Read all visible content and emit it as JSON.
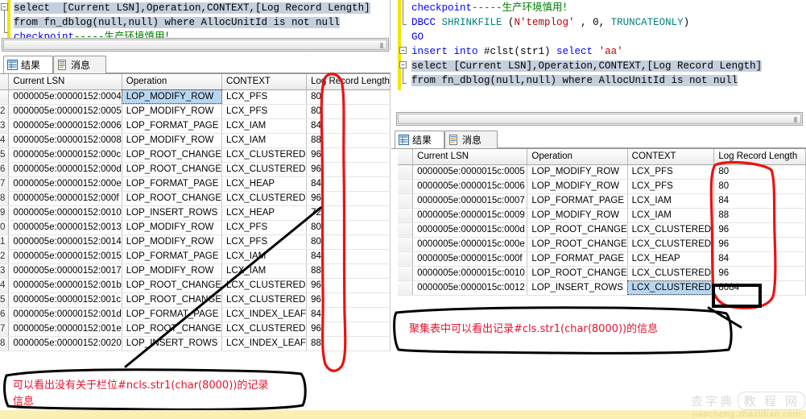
{
  "left_editor": {
    "lines": [
      {
        "segments": [
          {
            "t": "select  [Current LSN],Operation,CONTEXT,[Log Record Length]",
            "c": "sel"
          }
        ]
      },
      {
        "segments": [
          {
            "t": "from fn_dblog(null,null) where AllocUnitId is not null",
            "c": "sel"
          }
        ]
      },
      {
        "segments": [
          {
            "t": "checkpoint",
            "c": "kw"
          },
          {
            "t": "-----",
            "c": "green-note"
          },
          {
            "t": "生产环境慎用！",
            "c": "green-note"
          }
        ]
      }
    ]
  },
  "right_editor": {
    "lines": [
      {
        "segments": [
          {
            "t": "checkpoint",
            "c": "kw"
          },
          {
            "t": "-----",
            "c": "green-note"
          },
          {
            "t": "生产环境慎用！",
            "c": "green-note"
          }
        ]
      },
      {
        "segments": [
          {
            "t": "DBCC ",
            "c": "kw"
          },
          {
            "t": "SHRINKFILE",
            "c": "teal"
          },
          {
            "t": " (",
            "c": "fn"
          },
          {
            "t": "N'templog'",
            "c": "red"
          },
          {
            "t": " , ",
            "c": "fn"
          },
          {
            "t": "0",
            "c": "fn"
          },
          {
            "t": ", ",
            "c": "fn"
          },
          {
            "t": "TRUNCATEONLY",
            "c": "teal"
          },
          {
            "t": ")",
            "c": "fn"
          }
        ]
      },
      {
        "segments": [
          {
            "t": "GO",
            "c": "kw"
          }
        ]
      },
      {
        "segments": [
          {
            "t": "insert into ",
            "c": "kw"
          },
          {
            "t": "#clst",
            "c": "fn"
          },
          {
            "t": "(str1) ",
            "c": "fn"
          },
          {
            "t": "select ",
            "c": "kw"
          },
          {
            "t": "'aa'",
            "c": "red"
          }
        ]
      },
      {
        "segments": [
          {
            "t": "select [Current LSN],Operation,CONTEXT,[Log Record Length]",
            "c": "sel"
          }
        ]
      },
      {
        "segments": [
          {
            "t": "from fn_dblog(null,null) where AllocUnitId is not null",
            "c": "sel"
          }
        ]
      }
    ]
  },
  "scrollbar": {
    "grip_glyph": "⦀"
  },
  "tabs": {
    "results_label": "结果",
    "messages_label": "消息",
    "results_icon": "grid-icon",
    "messages_icon": "document-icon"
  },
  "left_grid": {
    "columns": [
      "",
      "Current LSN",
      "Operation",
      "CONTEXT",
      "Log Record Length"
    ],
    "rows": [
      {
        "n": "",
        "lsn": "0000005e:00000152:0004",
        "op": "LOP_MODIFY_ROW",
        "ctx": "LCX_PFS",
        "len": "80",
        "selected": true
      },
      {
        "n": "2",
        "lsn": "0000005e:00000152:0005",
        "op": "LOP_MODIFY_ROW",
        "ctx": "LCX_PFS",
        "len": "80"
      },
      {
        "n": "3",
        "lsn": "0000005e:00000152:0006",
        "op": "LOP_FORMAT_PAGE",
        "ctx": "LCX_IAM",
        "len": "84"
      },
      {
        "n": "4",
        "lsn": "0000005e:00000152:0008",
        "op": "LOP_MODIFY_ROW",
        "ctx": "LCX_IAM",
        "len": "88"
      },
      {
        "n": "5",
        "lsn": "0000005e:00000152:000c",
        "op": "LOP_ROOT_CHANGE",
        "ctx": "LCX_CLUSTERED",
        "len": "96"
      },
      {
        "n": "6",
        "lsn": "0000005e:00000152:000d",
        "op": "LOP_ROOT_CHANGE",
        "ctx": "LCX_CLUSTERED",
        "len": "96"
      },
      {
        "n": "7",
        "lsn": "0000005e:00000152:000e",
        "op": "LOP_FORMAT_PAGE",
        "ctx": "LCX_HEAP",
        "len": "84"
      },
      {
        "n": "8",
        "lsn": "0000005e:00000152:000f",
        "op": "LOP_ROOT_CHANGE",
        "ctx": "LCX_CLUSTERED",
        "len": "96"
      },
      {
        "n": "9",
        "lsn": "0000005e:00000152:0010",
        "op": "LOP_INSERT_ROWS",
        "ctx": "LCX_HEAP",
        "len": "72"
      },
      {
        "n": "0",
        "lsn": "0000005e:00000152:0013",
        "op": "LOP_MODIFY_ROW",
        "ctx": "LCX_PFS",
        "len": "80"
      },
      {
        "n": "1",
        "lsn": "0000005e:00000152:0014",
        "op": "LOP_MODIFY_ROW",
        "ctx": "LCX_PFS",
        "len": "80"
      },
      {
        "n": "2",
        "lsn": "0000005e:00000152:0015",
        "op": "LOP_FORMAT_PAGE",
        "ctx": "LCX_IAM",
        "len": "84"
      },
      {
        "n": "3",
        "lsn": "0000005e:00000152:0017",
        "op": "LOP_MODIFY_ROW",
        "ctx": "LCX_IAM",
        "len": "88"
      },
      {
        "n": "4",
        "lsn": "0000005e:00000152:001b",
        "op": "LOP_ROOT_CHANGE",
        "ctx": "LCX_CLUSTERED",
        "len": "96"
      },
      {
        "n": "5",
        "lsn": "0000005e:00000152:001c",
        "op": "LOP_ROOT_CHANGE",
        "ctx": "LCX_CLUSTERED",
        "len": "96"
      },
      {
        "n": "6",
        "lsn": "0000005e:00000152:001d",
        "op": "LOP_FORMAT_PAGE",
        "ctx": "LCX_INDEX_LEAF",
        "len": "84"
      },
      {
        "n": "7",
        "lsn": "0000005e:00000152:001e",
        "op": "LOP_ROOT_CHANGE",
        "ctx": "LCX_CLUSTERED",
        "len": "96"
      },
      {
        "n": "8",
        "lsn": "0000005e:00000152:0020",
        "op": "LOP_INSERT_ROWS",
        "ctx": "LCX_INDEX_LEAF",
        "len": "88"
      }
    ]
  },
  "right_grid": {
    "columns": [
      "",
      "Current LSN",
      "Operation",
      "CONTEXT",
      "Log Record Length"
    ],
    "rows": [
      {
        "n": "",
        "lsn": "0000005e:0000015c:0005",
        "op": "LOP_MODIFY_ROW",
        "ctx": "LCX_PFS",
        "len": "80"
      },
      {
        "n": "",
        "lsn": "0000005e:0000015c:0006",
        "op": "LOP_MODIFY_ROW",
        "ctx": "LCX_PFS",
        "len": "80"
      },
      {
        "n": "",
        "lsn": "0000005e:0000015c:0007",
        "op": "LOP_FORMAT_PAGE",
        "ctx": "LCX_IAM",
        "len": "84"
      },
      {
        "n": "",
        "lsn": "0000005e:0000015c:0009",
        "op": "LOP_MODIFY_ROW",
        "ctx": "LCX_IAM",
        "len": "88"
      },
      {
        "n": "",
        "lsn": "0000005e:0000015c:000d",
        "op": "LOP_ROOT_CHANGE",
        "ctx": "LCX_CLUSTERED",
        "len": "96"
      },
      {
        "n": "",
        "lsn": "0000005e:0000015c:000e",
        "op": "LOP_ROOT_CHANGE",
        "ctx": "LCX_CLUSTERED",
        "len": "96"
      },
      {
        "n": "",
        "lsn": "0000005e:0000015c:000f",
        "op": "LOP_FORMAT_PAGE",
        "ctx": "LCX_HEAP",
        "len": "84"
      },
      {
        "n": "",
        "lsn": "0000005e:0000015c:0010",
        "op": "LOP_ROOT_CHANGE",
        "ctx": "LCX_CLUSTERED",
        "len": "96"
      },
      {
        "n": "",
        "lsn": "0000005e:0000015c:0012",
        "op": "LOP_INSERT_ROWS",
        "ctx": "LCX_CLUSTERED",
        "len": "8084",
        "selected": true,
        "boxed": true
      }
    ]
  },
  "annotations": {
    "left_note_line1": "可以看出没有关于栏位#ncls.str1(char(8000))的记录",
    "left_note_line2": "信息",
    "right_note": "聚集表中可以看出记录#cls.str1(char(8000))的信息",
    "circle_color": "#ee1111",
    "box_color": "#000000",
    "text_color": "#e8112d"
  },
  "watermark": {
    "brand": "查字典",
    "boxed": "教 程 网",
    "url": "jiaocheng.zhazidian.com"
  }
}
